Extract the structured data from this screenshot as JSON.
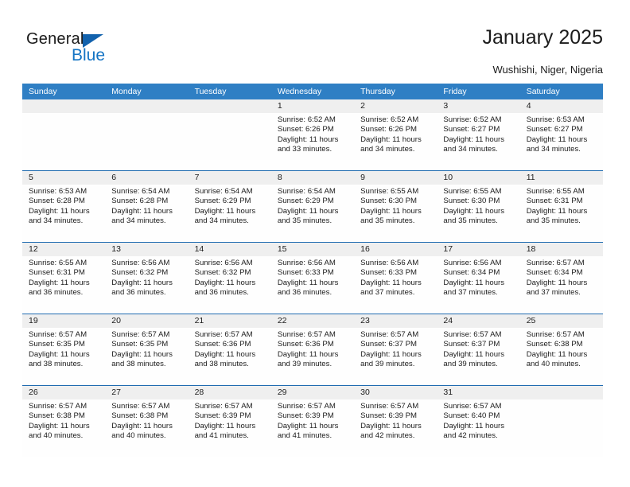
{
  "brand": {
    "name_part1": "General",
    "name_part2": "Blue",
    "triangle_color": "#1262ad",
    "blue_color": "#1474c4"
  },
  "header": {
    "title": "January 2025",
    "subtitle": "Wushishi, Niger, Nigeria"
  },
  "theme": {
    "header_bar_color": "#2f7fc4",
    "row_divider_color": "#1f6bb0",
    "date_band_color": "#efefef",
    "cell_color": "#fefefe"
  },
  "calendar": {
    "weekdays": [
      "Sunday",
      "Monday",
      "Tuesday",
      "Wednesday",
      "Thursday",
      "Friday",
      "Saturday"
    ],
    "labels": {
      "sunrise": "Sunrise:",
      "sunset": "Sunset:",
      "daylight": "Daylight:"
    },
    "weeks": [
      [
        {
          "day": "",
          "empty": true
        },
        {
          "day": "",
          "empty": true
        },
        {
          "day": "",
          "empty": true
        },
        {
          "day": "1",
          "sunrise": "Sunrise: 6:52 AM",
          "sunset": "Sunset: 6:26 PM",
          "daylight": "Daylight: 11 hours and 33 minutes."
        },
        {
          "day": "2",
          "sunrise": "Sunrise: 6:52 AM",
          "sunset": "Sunset: 6:26 PM",
          "daylight": "Daylight: 11 hours and 34 minutes."
        },
        {
          "day": "3",
          "sunrise": "Sunrise: 6:52 AM",
          "sunset": "Sunset: 6:27 PM",
          "daylight": "Daylight: 11 hours and 34 minutes."
        },
        {
          "day": "4",
          "sunrise": "Sunrise: 6:53 AM",
          "sunset": "Sunset: 6:27 PM",
          "daylight": "Daylight: 11 hours and 34 minutes."
        }
      ],
      [
        {
          "day": "5",
          "sunrise": "Sunrise: 6:53 AM",
          "sunset": "Sunset: 6:28 PM",
          "daylight": "Daylight: 11 hours and 34 minutes."
        },
        {
          "day": "6",
          "sunrise": "Sunrise: 6:54 AM",
          "sunset": "Sunset: 6:28 PM",
          "daylight": "Daylight: 11 hours and 34 minutes."
        },
        {
          "day": "7",
          "sunrise": "Sunrise: 6:54 AM",
          "sunset": "Sunset: 6:29 PM",
          "daylight": "Daylight: 11 hours and 34 minutes."
        },
        {
          "day": "8",
          "sunrise": "Sunrise: 6:54 AM",
          "sunset": "Sunset: 6:29 PM",
          "daylight": "Daylight: 11 hours and 35 minutes."
        },
        {
          "day": "9",
          "sunrise": "Sunrise: 6:55 AM",
          "sunset": "Sunset: 6:30 PM",
          "daylight": "Daylight: 11 hours and 35 minutes."
        },
        {
          "day": "10",
          "sunrise": "Sunrise: 6:55 AM",
          "sunset": "Sunset: 6:30 PM",
          "daylight": "Daylight: 11 hours and 35 minutes."
        },
        {
          "day": "11",
          "sunrise": "Sunrise: 6:55 AM",
          "sunset": "Sunset: 6:31 PM",
          "daylight": "Daylight: 11 hours and 35 minutes."
        }
      ],
      [
        {
          "day": "12",
          "sunrise": "Sunrise: 6:55 AM",
          "sunset": "Sunset: 6:31 PM",
          "daylight": "Daylight: 11 hours and 36 minutes."
        },
        {
          "day": "13",
          "sunrise": "Sunrise: 6:56 AM",
          "sunset": "Sunset: 6:32 PM",
          "daylight": "Daylight: 11 hours and 36 minutes."
        },
        {
          "day": "14",
          "sunrise": "Sunrise: 6:56 AM",
          "sunset": "Sunset: 6:32 PM",
          "daylight": "Daylight: 11 hours and 36 minutes."
        },
        {
          "day": "15",
          "sunrise": "Sunrise: 6:56 AM",
          "sunset": "Sunset: 6:33 PM",
          "daylight": "Daylight: 11 hours and 36 minutes."
        },
        {
          "day": "16",
          "sunrise": "Sunrise: 6:56 AM",
          "sunset": "Sunset: 6:33 PM",
          "daylight": "Daylight: 11 hours and 37 minutes."
        },
        {
          "day": "17",
          "sunrise": "Sunrise: 6:56 AM",
          "sunset": "Sunset: 6:34 PM",
          "daylight": "Daylight: 11 hours and 37 minutes."
        },
        {
          "day": "18",
          "sunrise": "Sunrise: 6:57 AM",
          "sunset": "Sunset: 6:34 PM",
          "daylight": "Daylight: 11 hours and 37 minutes."
        }
      ],
      [
        {
          "day": "19",
          "sunrise": "Sunrise: 6:57 AM",
          "sunset": "Sunset: 6:35 PM",
          "daylight": "Daylight: 11 hours and 38 minutes."
        },
        {
          "day": "20",
          "sunrise": "Sunrise: 6:57 AM",
          "sunset": "Sunset: 6:35 PM",
          "daylight": "Daylight: 11 hours and 38 minutes."
        },
        {
          "day": "21",
          "sunrise": "Sunrise: 6:57 AM",
          "sunset": "Sunset: 6:36 PM",
          "daylight": "Daylight: 11 hours and 38 minutes."
        },
        {
          "day": "22",
          "sunrise": "Sunrise: 6:57 AM",
          "sunset": "Sunset: 6:36 PM",
          "daylight": "Daylight: 11 hours and 39 minutes."
        },
        {
          "day": "23",
          "sunrise": "Sunrise: 6:57 AM",
          "sunset": "Sunset: 6:37 PM",
          "daylight": "Daylight: 11 hours and 39 minutes."
        },
        {
          "day": "24",
          "sunrise": "Sunrise: 6:57 AM",
          "sunset": "Sunset: 6:37 PM",
          "daylight": "Daylight: 11 hours and 39 minutes."
        },
        {
          "day": "25",
          "sunrise": "Sunrise: 6:57 AM",
          "sunset": "Sunset: 6:38 PM",
          "daylight": "Daylight: 11 hours and 40 minutes."
        }
      ],
      [
        {
          "day": "26",
          "sunrise": "Sunrise: 6:57 AM",
          "sunset": "Sunset: 6:38 PM",
          "daylight": "Daylight: 11 hours and 40 minutes."
        },
        {
          "day": "27",
          "sunrise": "Sunrise: 6:57 AM",
          "sunset": "Sunset: 6:38 PM",
          "daylight": "Daylight: 11 hours and 40 minutes."
        },
        {
          "day": "28",
          "sunrise": "Sunrise: 6:57 AM",
          "sunset": "Sunset: 6:39 PM",
          "daylight": "Daylight: 11 hours and 41 minutes."
        },
        {
          "day": "29",
          "sunrise": "Sunrise: 6:57 AM",
          "sunset": "Sunset: 6:39 PM",
          "daylight": "Daylight: 11 hours and 41 minutes."
        },
        {
          "day": "30",
          "sunrise": "Sunrise: 6:57 AM",
          "sunset": "Sunset: 6:39 PM",
          "daylight": "Daylight: 11 hours and 42 minutes."
        },
        {
          "day": "31",
          "sunrise": "Sunrise: 6:57 AM",
          "sunset": "Sunset: 6:40 PM",
          "daylight": "Daylight: 11 hours and 42 minutes."
        },
        {
          "day": "",
          "empty": true
        }
      ]
    ]
  }
}
